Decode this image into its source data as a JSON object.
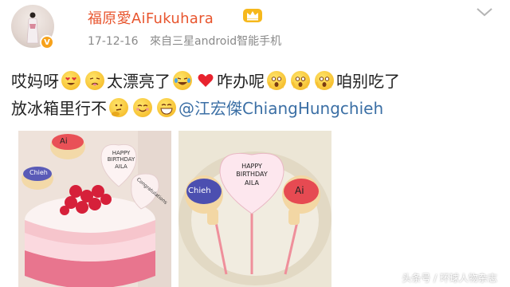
{
  "post": {
    "username": "福原愛AiFukuhara",
    "date": "17-12-16",
    "source": "來自三星android智能手机",
    "line1": {
      "t1": "哎妈呀",
      "t2": "太漂亮了",
      "t3": "咋办呢",
      "t4": "咱别吃了"
    },
    "line2": {
      "t1": "放冰箱里行不",
      "mention": "@江宏傑ChiangHungchieh"
    }
  },
  "photos": {
    "left": {
      "cookie_heart": "HAPPY BIRTHDAY AILA",
      "paddle_a": "Ai",
      "paddle_b": "Chieh",
      "cookie_c": "Congratulations"
    },
    "right": {
      "heart_text": "HAPPY BIRTHDAY AILA",
      "paddle_left": "Chieh",
      "paddle_right": "Ai"
    }
  },
  "watermark": "头条号 / 环球人物杂志",
  "icons": {
    "avatar": "avatar",
    "verified": "verified-badge-icon",
    "crown": "crown-icon",
    "menu": "chevron-down-icon"
  },
  "colors": {
    "username": "#e8552e",
    "mention": "#3b6fa5",
    "verified": "#f7a21b"
  }
}
